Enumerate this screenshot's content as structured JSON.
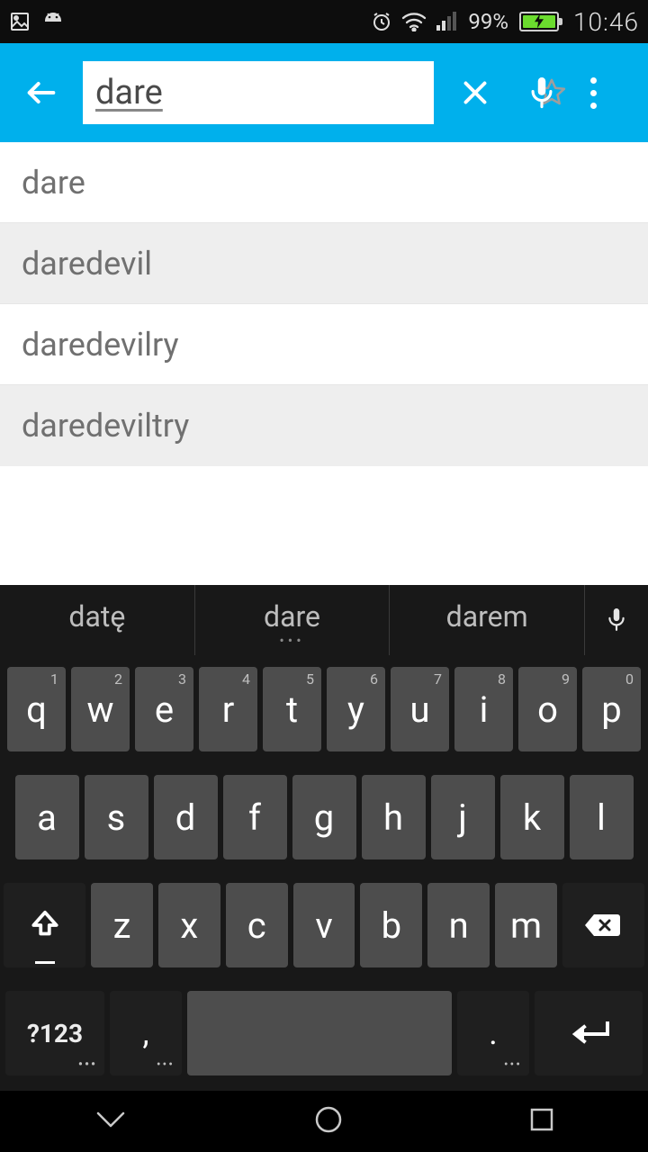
{
  "status": {
    "battery": "99%",
    "time": "10:46"
  },
  "search": {
    "value": "dare"
  },
  "suggestions": [
    "dare",
    "daredevil",
    "daredevilry",
    "daredeviltry"
  ],
  "predictions": [
    "datę",
    "dare",
    "darem"
  ],
  "keys": {
    "row1": [
      "q",
      "w",
      "e",
      "r",
      "t",
      "y",
      "u",
      "i",
      "o",
      "p"
    ],
    "row1hints": [
      "1",
      "2",
      "3",
      "4",
      "5",
      "6",
      "7",
      "8",
      "9",
      "0"
    ],
    "row2": [
      "a",
      "s",
      "d",
      "f",
      "g",
      "h",
      "j",
      "k",
      "l"
    ],
    "row3": [
      "z",
      "x",
      "c",
      "v",
      "b",
      "n",
      "m"
    ],
    "sym": "?123",
    "comma": ",",
    "period": "."
  }
}
